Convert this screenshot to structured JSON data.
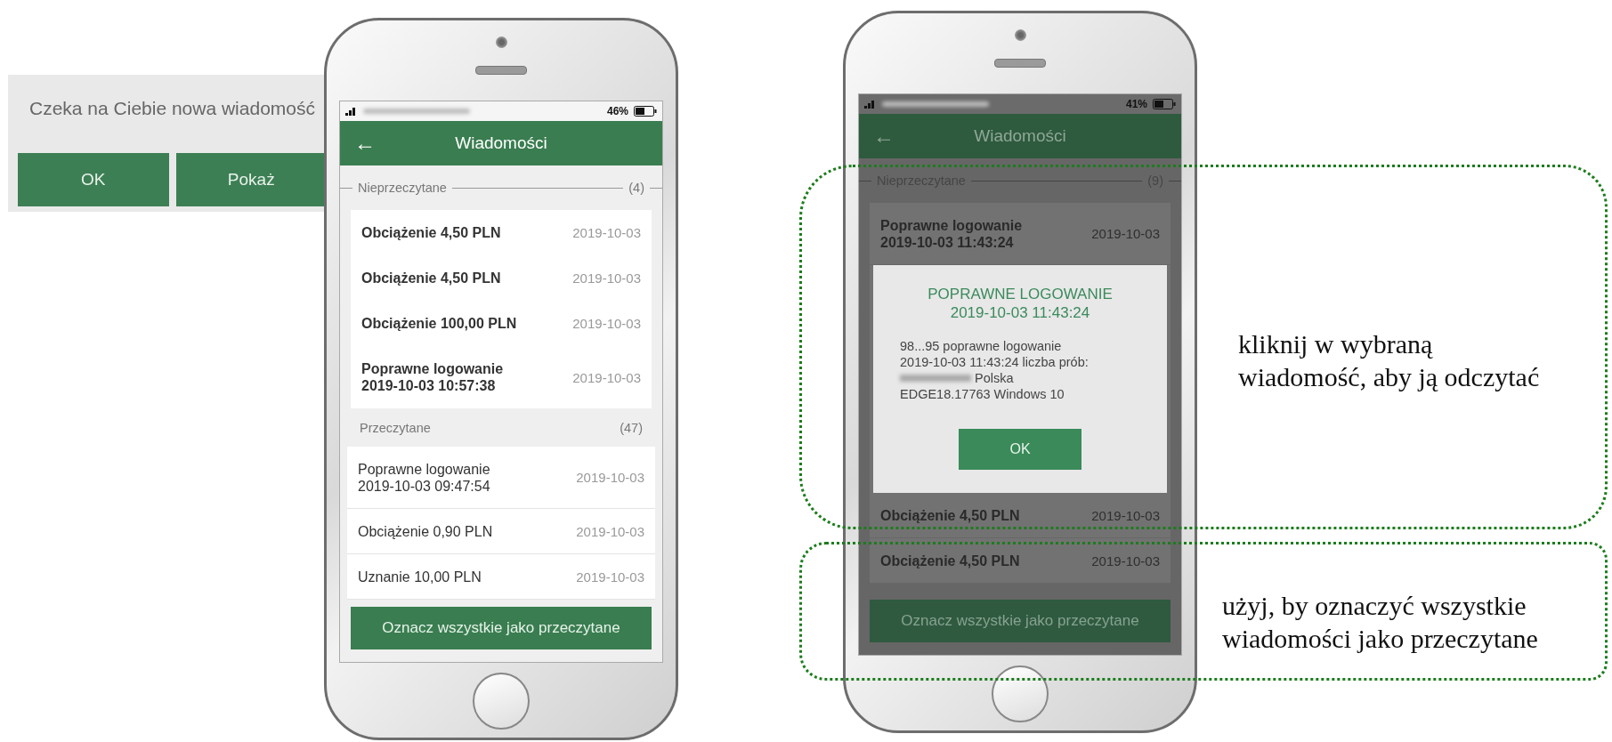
{
  "notification": {
    "message": "Czeka na Ciebie nowa wiadomość",
    "buttons": [
      "OK",
      "Pokaż"
    ]
  },
  "phones": [
    {
      "dimmed": false,
      "status": {
        "battery": "46%"
      },
      "header": {
        "back": "←",
        "title": "Wiadomości"
      },
      "sections": [
        {
          "kind": "unread",
          "title": "Nieprzeczytane",
          "count": "(4)",
          "messages": [
            {
              "title": "Obciążenie 4,50 PLN",
              "date": "2019-10-03"
            },
            {
              "title": "Obciążenie 4,50 PLN",
              "date": "2019-10-03"
            },
            {
              "title": "Obciążenie 100,00 PLN",
              "date": "2019-10-03"
            },
            {
              "title": "Poprawne logowanie\n2019-10-03 10:57:38",
              "date": "2019-10-03"
            }
          ]
        },
        {
          "kind": "read",
          "title": "Przeczytane",
          "count": "(47)",
          "messages": [
            {
              "title": "Poprawne logowanie\n2019-10-03 09:47:54",
              "date": "2019-10-03"
            },
            {
              "title": "Obciążenie 0,90 PLN",
              "date": "2019-10-03"
            },
            {
              "title": "Uznanie 10,00 PLN",
              "date": "2019-10-03"
            }
          ]
        }
      ],
      "action_button": "Oznacz wszystkie jako przeczytane"
    },
    {
      "dimmed": true,
      "status": {
        "battery": "41%"
      },
      "header": {
        "back": "←",
        "title": "Wiadomości"
      },
      "sections": [
        {
          "kind": "unread",
          "title": "Nieprzeczytane",
          "count": "(9)",
          "messages": [
            {
              "title": "Poprawne logowanie\n2019-10-03 11:43:24",
              "date": "2019-10-03"
            },
            {
              "title": "Obciążenie 4,50 PLN",
              "date": "2019-10-03"
            },
            {
              "title": "Obciążenie 4,50 PLN",
              "date": "2019-10-03"
            }
          ]
        }
      ],
      "dialog": {
        "title": "POPRAWNE LOGOWANIE\n2019-10-03 11:43:24",
        "lines": [
          "98...95 poprawne logowanie",
          "2019-10-03 11:43:24 liczba prób:"
        ],
        "location": "Polska",
        "browser": "EDGE18.17763 Windows 10",
        "button": "OK"
      },
      "action_button": "Oznacz wszystkie jako przeczytane"
    }
  ],
  "callouts": [
    {
      "text": "kliknij w wybraną\nwiadomość, aby ją odczytać"
    },
    {
      "text": "użyj, by oznaczyć wszystkie\nwiadomości jako przeczytane"
    }
  ]
}
